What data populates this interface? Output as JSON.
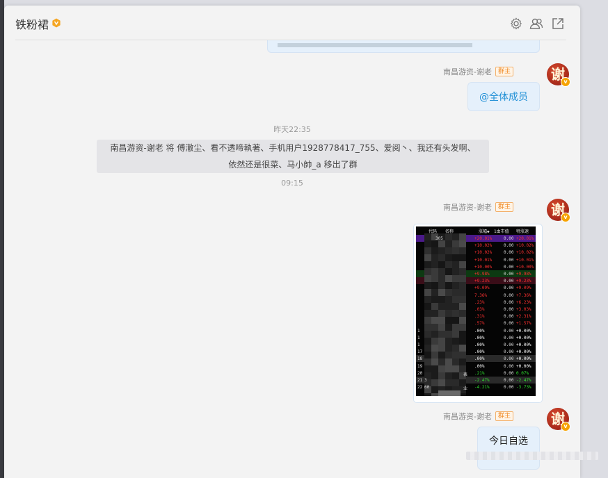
{
  "window": {
    "title": "铁粉裙"
  },
  "header": {
    "icons": [
      "settings-icon",
      "members-icon",
      "popout-icon"
    ]
  },
  "messages": {
    "sender_name": "南昌游资-谢老",
    "owner_tag": "群主",
    "avatar_char": "谢",
    "at_all": "@全体成员",
    "time1": "昨天22:35",
    "notice_line1": "南昌游资-谢老 将 傅澈尘、看不透啼執著、手机用户1928778417_755、爱阅丶、我还有头发啊、",
    "notice_line2": "依然还是很菜、马小帥_a 移出了群",
    "time2": "09:15",
    "last_text": "今日自选"
  },
  "stock_image": {
    "headers": [
      "代码",
      "名称",
      "涨幅◆",
      "1由市值",
      "特涨速"
    ],
    "rows": [
      {
        "idx": "",
        "chg": "+20.01%",
        "mcap": "0.00",
        "spd": "+20.01%",
        "color": "#ff3030",
        "bg": "#4b1a8a"
      },
      {
        "idx": "",
        "chg": "+10.02%",
        "mcap": "0.00",
        "spd": "+10.02%",
        "color": "#ff3030",
        "bg": ""
      },
      {
        "idx": "",
        "chg": "+10.02%",
        "mcap": "0.00",
        "spd": "+10.02%",
        "color": "#ff3030",
        "bg": ""
      },
      {
        "idx": "",
        "chg": "+10.01%",
        "mcap": "0.00",
        "spd": "+10.01%",
        "color": "#ff3030",
        "bg": ""
      },
      {
        "idx": "",
        "chg": "+10.00%",
        "mcap": "0.00",
        "spd": "+10.00%",
        "color": "#ff3030",
        "bg": ""
      },
      {
        "idx": "",
        "chg": "+9.98%",
        "mcap": "0.00",
        "spd": "+9.98%",
        "color": "#ff3030",
        "bg": "#0d3a12"
      },
      {
        "idx": "",
        "chg": "+9.23%",
        "mcap": "0.00",
        "spd": "+9.23%",
        "color": "#ff3030",
        "bg": "#3a0d18"
      },
      {
        "idx": "",
        "chg": "+9.09%",
        "mcap": "0.00",
        "spd": "+9.09%",
        "color": "#ff3030",
        "bg": ""
      },
      {
        "idx": "",
        "chg": "7.36%",
        "mcap": "0.00",
        "spd": "+7.36%",
        "color": "#ff3030",
        "bg": ""
      },
      {
        "idx": "",
        "chg": ".23%",
        "mcap": "0.00",
        "spd": "+6.23%",
        "color": "#ff3030",
        "bg": ""
      },
      {
        "idx": "",
        "chg": ".03%",
        "mcap": "0.00",
        "spd": "+3.03%",
        "color": "#ff3030",
        "bg": ""
      },
      {
        "idx": "",
        "chg": ".31%",
        "mcap": "0.00",
        "spd": "+2.31%",
        "color": "#ff3030",
        "bg": ""
      },
      {
        "idx": "",
        "chg": ".57%",
        "mcap": "0.00",
        "spd": "+1.57%",
        "color": "#ff3030",
        "bg": ""
      },
      {
        "idx": "1",
        "chg": ".00%",
        "mcap": "0.00",
        "spd": "+0.00%",
        "color": "#ffffff",
        "bg": ""
      },
      {
        "idx": "1",
        "chg": ".00%",
        "mcap": "0.00",
        "spd": "+0.00%",
        "color": "#ffffff",
        "bg": ""
      },
      {
        "idx": "1",
        "chg": ".00%",
        "mcap": "0.00",
        "spd": "+0.00%",
        "color": "#ffffff",
        "bg": ""
      },
      {
        "idx": "17",
        "chg": ".00%",
        "mcap": "0.00",
        "spd": "+0.00%",
        "color": "#ffffff",
        "bg": ""
      },
      {
        "idx": "18",
        "chg": ".00%",
        "mcap": "0.00",
        "spd": "+0.00%",
        "color": "#ffffff",
        "bg": "#2a2a2a"
      },
      {
        "idx": "19",
        "chg": ".00%",
        "mcap": "0.00",
        "spd": "+0.00%",
        "color": "#ffffff",
        "bg": ""
      },
      {
        "idx": "20",
        "chg": ".21%",
        "mcap": "0.00",
        "spd": "0.07%",
        "color": "#30e030",
        "bg": ""
      },
      {
        "idx": "21",
        "chg": "-2.47%",
        "mcap": "0.00",
        "spd": "-2.47%",
        "color": "#30e030",
        "bg": "#2a2a2a"
      },
      {
        "idx": "22",
        "chg": "-4.21%",
        "mcap": "0.00",
        "spd": "-3.73%",
        "color": "#30e030",
        "bg": ""
      }
    ],
    "name_fragments": [
      {
        "row": 19,
        "text": "表"
      },
      {
        "row": 21,
        "text": "业"
      }
    ],
    "code_fragments": [
      {
        "row": 0,
        "text": "305"
      },
      {
        "row": 20,
        "text": "3"
      },
      {
        "row": 21,
        "text": "60"
      }
    ]
  }
}
